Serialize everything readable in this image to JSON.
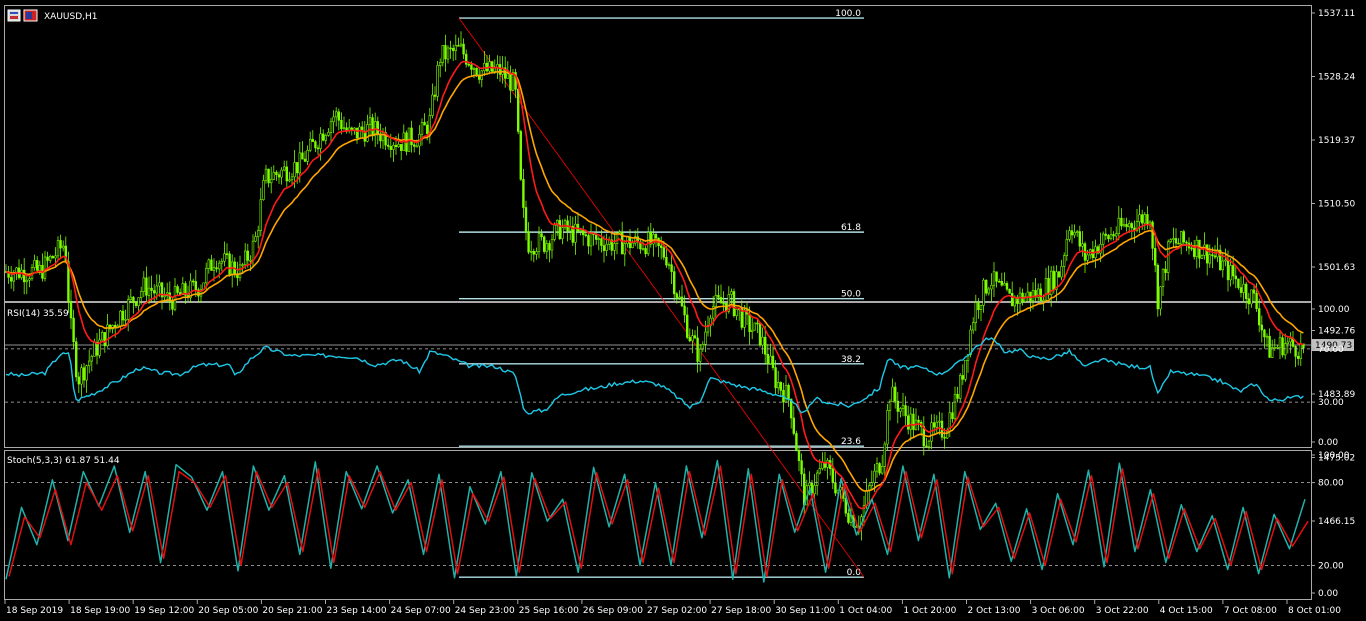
{
  "chart_data": [
    {
      "type": "candlestick",
      "title": "XAUUSD,H1",
      "symbol_icon": "chart-window-icon",
      "y_ticks": [
        "1537.11",
        "1528.24",
        "1519.37",
        "1510.50",
        "1501.63",
        "1492.76",
        "1483.89",
        "1475.02",
        "1466.15"
      ],
      "ylim": [
        1460,
        1538
      ],
      "current_price": "1490.73",
      "current_price_value": 1490.73,
      "colors": {
        "bull": "#7cfc00",
        "bear": "#7cfc00",
        "ma_fast": "#ff1a1a",
        "ma_slow": "#ffa500",
        "fib": "#b0e0e6",
        "trend": "#ff0000",
        "price_line": "#c0c0c0"
      },
      "price_path": [
        [
          0,
          1501
        ],
        [
          40,
          1501
        ],
        [
          65,
          1505
        ],
        [
          70,
          1494
        ],
        [
          78,
          1486
        ],
        [
          95,
          1490
        ],
        [
          120,
          1495
        ],
        [
          145,
          1499
        ],
        [
          170,
          1497
        ],
        [
          200,
          1499
        ],
        [
          215,
          1503
        ],
        [
          240,
          1501
        ],
        [
          255,
          1505
        ],
        [
          265,
          1514
        ],
        [
          300,
          1516
        ],
        [
          335,
          1523
        ],
        [
          350,
          1520
        ],
        [
          370,
          1521
        ],
        [
          400,
          1519
        ],
        [
          420,
          1520
        ],
        [
          430,
          1522
        ],
        [
          440,
          1531
        ],
        [
          460,
          1532
        ],
        [
          480,
          1529
        ],
        [
          500,
          1529
        ],
        [
          515,
          1527
        ],
        [
          522,
          1510
        ],
        [
          528,
          1505
        ],
        [
          545,
          1505
        ],
        [
          560,
          1507
        ],
        [
          580,
          1506
        ],
        [
          610,
          1505
        ],
        [
          650,
          1505
        ],
        [
          668,
          1503
        ],
        [
          675,
          1499
        ],
        [
          690,
          1492
        ],
        [
          700,
          1489
        ],
        [
          710,
          1496
        ],
        [
          730,
          1497
        ],
        [
          745,
          1494
        ],
        [
          760,
          1492
        ],
        [
          775,
          1486
        ],
        [
          790,
          1483
        ],
        [
          800,
          1473
        ],
        [
          805,
          1469
        ],
        [
          815,
          1472
        ],
        [
          825,
          1474
        ],
        [
          840,
          1470
        ],
        [
          850,
          1467
        ],
        [
          860,
          1466
        ],
        [
          870,
          1471
        ],
        [
          882,
          1475
        ],
        [
          890,
          1484
        ],
        [
          905,
          1481
        ],
        [
          925,
          1478
        ],
        [
          945,
          1479
        ],
        [
          960,
          1485
        ],
        [
          975,
          1496
        ],
        [
          990,
          1500
        ],
        [
          1010,
          1497
        ],
        [
          1040,
          1498
        ],
        [
          1060,
          1501
        ],
        [
          1070,
          1508
        ],
        [
          1085,
          1503
        ],
        [
          1100,
          1505
        ],
        [
          1120,
          1507
        ],
        [
          1150,
          1509
        ],
        [
          1158,
          1497
        ],
        [
          1170,
          1505
        ],
        [
          1190,
          1505
        ],
        [
          1215,
          1503
        ],
        [
          1235,
          1500
        ],
        [
          1255,
          1497
        ],
        [
          1268,
          1490
        ],
        [
          1285,
          1491
        ],
        [
          1305,
          1490
        ]
      ],
      "fibonacci": {
        "levels": [
          {
            "label": "100.0",
            "price": 1536.4
          },
          {
            "label": "61.8",
            "price": 1506.5
          },
          {
            "label": "50.0",
            "price": 1497.2
          },
          {
            "label": "38.2",
            "price": 1488.1
          },
          {
            "label": "23.6",
            "price": 1476.6
          },
          {
            "label": "0.0",
            "price": 1458.3
          }
        ]
      },
      "x_ticks": [
        "18 Sep 2019",
        "18 Sep 19:00",
        "19 Sep 12:00",
        "20 Sep 05:00",
        "20 Sep 21:00",
        "23 Sep 14:00",
        "24 Sep 07:00",
        "24 Sep 23:00",
        "25 Sep 16:00",
        "26 Sep 09:00",
        "27 Sep 02:00",
        "27 Sep 18:00",
        "30 Sep 11:00",
        "1 Oct 04:00",
        "1 Oct 20:00",
        "2 Oct 13:00",
        "3 Oct 06:00",
        "3 Oct 22:00",
        "4 Oct 15:00",
        "7 Oct 08:00",
        "8 Oct 01:00"
      ]
    },
    {
      "type": "line",
      "title": "RSI(14) 35.59",
      "ylim": [
        0,
        100
      ],
      "y_ticks": [
        "100.00",
        "70.00",
        "30.00",
        "0.00"
      ],
      "levels": [
        70,
        30
      ],
      "color": "#1ec8e6",
      "rsi_path": [
        [
          0,
          52
        ],
        [
          20,
          50
        ],
        [
          45,
          52
        ],
        [
          60,
          66
        ],
        [
          70,
          66
        ],
        [
          75,
          31
        ],
        [
          95,
          37
        ],
        [
          120,
          47
        ],
        [
          140,
          56
        ],
        [
          160,
          52
        ],
        [
          180,
          51
        ],
        [
          200,
          58
        ],
        [
          230,
          58
        ],
        [
          235,
          49
        ],
        [
          250,
          62
        ],
        [
          265,
          71
        ],
        [
          290,
          65
        ],
        [
          310,
          65
        ],
        [
          330,
          65
        ],
        [
          355,
          64
        ],
        [
          375,
          58
        ],
        [
          400,
          62
        ],
        [
          420,
          53
        ],
        [
          430,
          68
        ],
        [
          445,
          65
        ],
        [
          470,
          57
        ],
        [
          495,
          57
        ],
        [
          515,
          51
        ],
        [
          525,
          22
        ],
        [
          545,
          24
        ],
        [
          560,
          35
        ],
        [
          580,
          39
        ],
        [
          600,
          41
        ],
        [
          615,
          44
        ],
        [
          640,
          46
        ],
        [
          660,
          43
        ],
        [
          670,
          38
        ],
        [
          690,
          26
        ],
        [
          700,
          31
        ],
        [
          710,
          48
        ],
        [
          740,
          42
        ],
        [
          760,
          39
        ],
        [
          780,
          35
        ],
        [
          795,
          28
        ],
        [
          805,
          21
        ],
        [
          815,
          33
        ],
        [
          830,
          29
        ],
        [
          850,
          27
        ],
        [
          865,
          33
        ],
        [
          880,
          41
        ],
        [
          888,
          64
        ],
        [
          900,
          56
        ],
        [
          920,
          56
        ],
        [
          940,
          51
        ],
        [
          960,
          60
        ],
        [
          975,
          71
        ],
        [
          990,
          79
        ],
        [
          1005,
          68
        ],
        [
          1020,
          69
        ],
        [
          1035,
          63
        ],
        [
          1050,
          63
        ],
        [
          1070,
          68
        ],
        [
          1085,
          56
        ],
        [
          1100,
          62
        ],
        [
          1130,
          57
        ],
        [
          1150,
          56
        ],
        [
          1158,
          35
        ],
        [
          1170,
          53
        ],
        [
          1200,
          50
        ],
        [
          1220,
          46
        ],
        [
          1240,
          38
        ],
        [
          1255,
          44
        ],
        [
          1270,
          31
        ],
        [
          1290,
          33
        ],
        [
          1305,
          35
        ]
      ]
    },
    {
      "type": "line",
      "title": "Stoch(5,3,3) 61.87 51.44",
      "ylim": [
        0,
        100
      ],
      "y_ticks": [
        "100.00",
        "80.00",
        "20.00",
        "0.00"
      ],
      "levels": [
        80,
        20
      ],
      "series": [
        {
          "color": "#20b2aa",
          "values": [
            10,
            62,
            35,
            82,
            38,
            88,
            63,
            92,
            44,
            88,
            22,
            93,
            84,
            60,
            88,
            16,
            92,
            60,
            85,
            28,
            95,
            18,
            88,
            61,
            92,
            58,
            82,
            28,
            86,
            11,
            77,
            50,
            88,
            12,
            87,
            52,
            68,
            15,
            91,
            48,
            86,
            20,
            80,
            20,
            92,
            40,
            96,
            10,
            90,
            8,
            86,
            44,
            76,
            15,
            83,
            42,
            68,
            28,
            92,
            38,
            86,
            11,
            88,
            46,
            65,
            23,
            61,
            17,
            72,
            35,
            89,
            19,
            94,
            30,
            75,
            22,
            64,
            30,
            56,
            17,
            62,
            14,
            57,
            32,
            68
          ]
        },
        {
          "color": "#e01010",
          "values": [
            12,
            55,
            40,
            75,
            35,
            80,
            60,
            85,
            45,
            85,
            25,
            88,
            80,
            62,
            85,
            20,
            88,
            62,
            80,
            30,
            90,
            22,
            85,
            62,
            88,
            60,
            80,
            30,
            82,
            14,
            72,
            52,
            84,
            15,
            83,
            54,
            66,
            18,
            87,
            50,
            82,
            22,
            76,
            22,
            88,
            42,
            92,
            14,
            86,
            12,
            82,
            45,
            72,
            18,
            79,
            44,
            65,
            30,
            88,
            40,
            82,
            14,
            84,
            48,
            62,
            25,
            58,
            20,
            68,
            37,
            85,
            22,
            90,
            32,
            72,
            25,
            61,
            32,
            54,
            20,
            59,
            17,
            54,
            34,
            52
          ]
        }
      ]
    }
  ]
}
